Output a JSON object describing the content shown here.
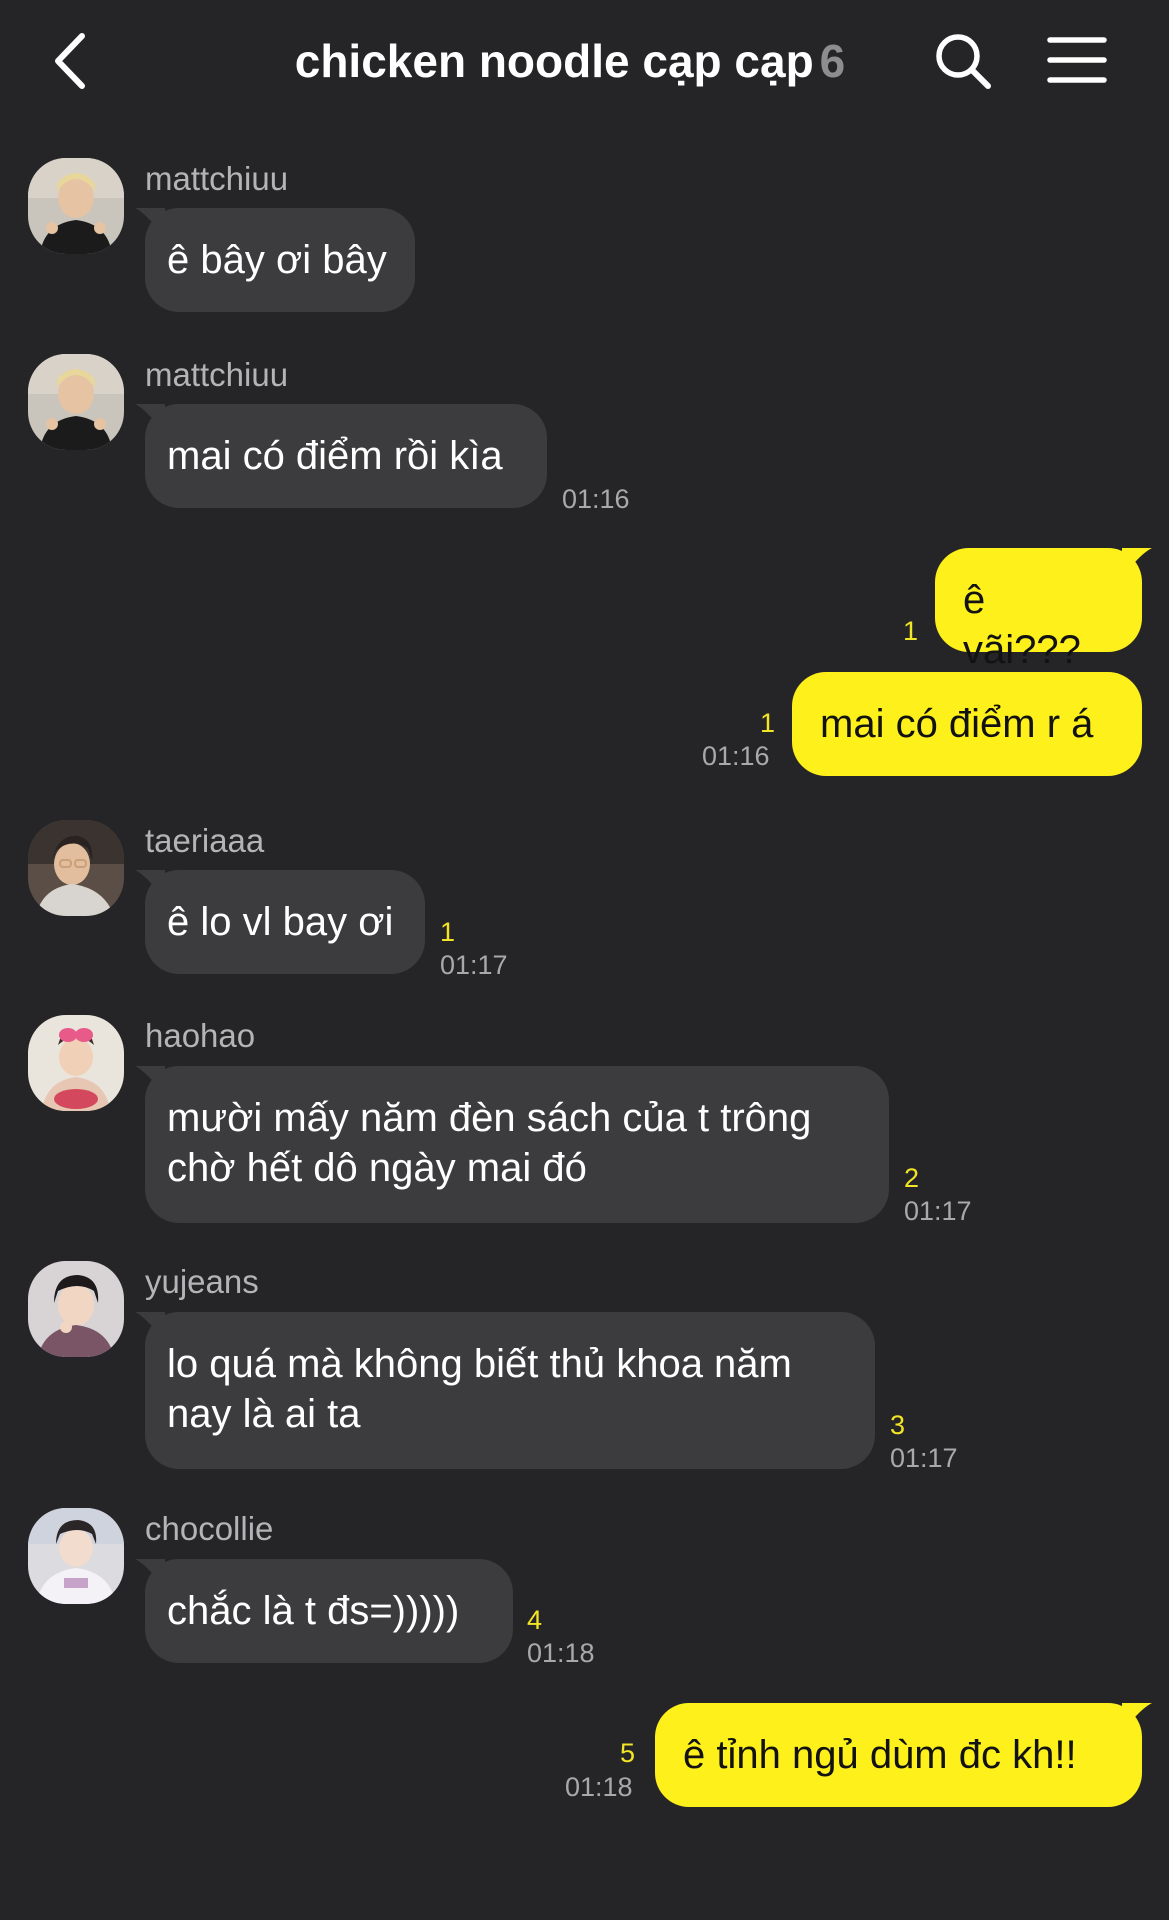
{
  "header": {
    "title": "chicken noodle cạp cạp",
    "member_count": "6",
    "back_icon": "chevron-left-icon",
    "search_icon": "search-icon",
    "menu_icon": "hamburger-menu-icon"
  },
  "colors": {
    "background": "#252527",
    "incoming_bubble": "#3c3c3e",
    "outgoing_bubble": "#fef01b",
    "unread_count": "#f2e426",
    "timestamp": "#a9a9ac"
  },
  "messages": [
    {
      "sender": "mattchiuu",
      "text": "ê bây ơi bây"
    },
    {
      "sender": "mattchiuu",
      "text": "mai có điểm rồi kìa",
      "time": "01:16"
    },
    {
      "text": "ê vãi???",
      "unread": "1"
    },
    {
      "text": "mai có điểm r á",
      "unread": "1",
      "time": "01:16"
    },
    {
      "sender": "taeriaaa",
      "text": "ê lo vl bay ơi",
      "unread": "1",
      "time": "01:17"
    },
    {
      "sender": "haohao",
      "text": "mười mấy năm đèn sách của t trông chờ hết dô ngày mai đó",
      "unread": "2",
      "time": "01:17"
    },
    {
      "sender": "yujeans",
      "text": "lo quá mà không biết thủ khoa năm nay là ai ta",
      "unread": "3",
      "time": "01:17"
    },
    {
      "sender": "chocollie",
      "text": "chắc là t đs=)))))",
      "unread": "4",
      "time": "01:18"
    },
    {
      "text": "ê tỉnh ngủ dùm đc kh!!",
      "unread": "5",
      "time": "01:18"
    }
  ]
}
